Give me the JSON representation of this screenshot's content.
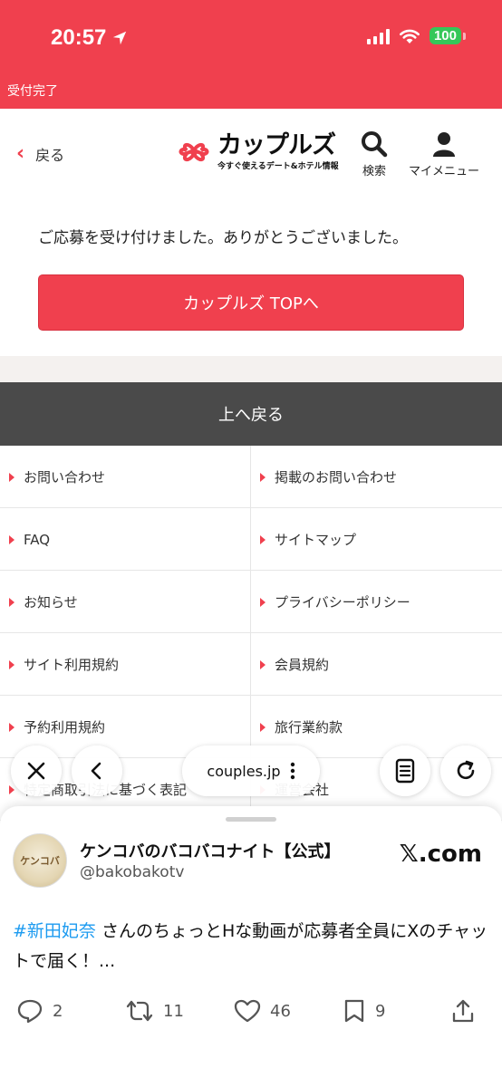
{
  "status_bar": {
    "time": "20:57",
    "battery": "100"
  },
  "top_banner": {
    "text": "受付完了"
  },
  "header": {
    "back_label": "戻る",
    "logo_name": "カップルズ",
    "logo_tagline": "今すぐ使えるデート&ホテル情報",
    "search_label": "検索",
    "menu_label": "マイメニュー"
  },
  "main": {
    "message": "ご応募を受け付けました。ありがとうございました。",
    "cta_label": "カップルズ TOPへ",
    "back_to_top": "上へ戻る"
  },
  "footer_links": [
    [
      "お問い合わせ",
      "掲載のお問い合わせ"
    ],
    [
      "FAQ",
      "サイトマップ"
    ],
    [
      "お知らせ",
      "プライバシーポリシー"
    ],
    [
      "サイト利用規約",
      "会員規約"
    ],
    [
      "予約利用規約",
      "旅行業約款"
    ],
    [
      "特定商取引法に基づく表記",
      "運営会社"
    ]
  ],
  "browser": {
    "url": "couples.jp"
  },
  "tweet_card": {
    "account_name": "ケンコバのバコバコナイト【公式】",
    "handle": "@bakobakotv",
    "source": "𝕏.com",
    "hashtag": "#新田妃奈",
    "text": " さんのちょっとHな動画が応募者全員にXのチャットで届く！...",
    "replies": "2",
    "reposts": "11",
    "likes": "46",
    "bookmarks": "9"
  },
  "colors": {
    "brand": "#f0404e",
    "dark_bar": "#4a4a4a",
    "link": "#1d9bf0"
  }
}
